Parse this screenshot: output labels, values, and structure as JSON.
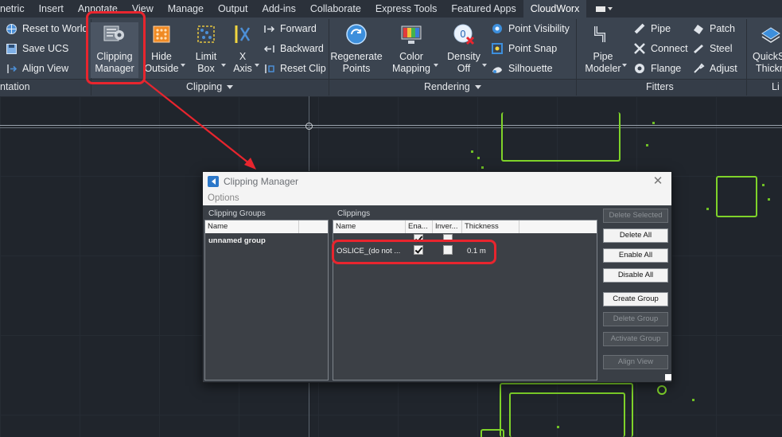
{
  "menubar": {
    "tabs": [
      "netric",
      "Insert",
      "Annotate",
      "View",
      "Manage",
      "Output",
      "Add-ins",
      "Collaborate",
      "Express Tools",
      "Featured Apps",
      "CloudWorx"
    ],
    "active": "CloudWorx"
  },
  "ribbon": {
    "view_panel": {
      "label": "ntation",
      "buttons": [
        "Reset to World",
        "Save UCS",
        "Align View"
      ]
    },
    "clipping_panel": {
      "label": "Clipping",
      "clipping_manager": [
        "Clipping",
        "Manager"
      ],
      "hide_outside": [
        "Hide",
        "Outside"
      ],
      "limit_box": [
        "Limit",
        "Box"
      ],
      "x_axis": [
        "X",
        "Axis"
      ],
      "forward": "Forward",
      "backward": "Backward",
      "reset_clip": "Reset Clip"
    },
    "rendering_panel": {
      "label": "Rendering",
      "regenerate_points": [
        "Regenerate",
        "Points"
      ],
      "color_mapping": [
        "Color",
        "Mapping"
      ],
      "density_off": [
        "Density",
        "Off"
      ],
      "point_visibility": "Point Visibility",
      "point_snap": "Point Snap",
      "silhouette": "Silhouette"
    },
    "fitters_panel": {
      "label": "Fitters",
      "pipe_modeler": [
        "Pipe",
        "Modeler"
      ],
      "pipe": "Pipe",
      "connect": "Connect",
      "flange": "Flange",
      "patch": "Patch",
      "steel": "Steel",
      "adjust": "Adjust"
    },
    "quick_panel": {
      "label": "Li",
      "quicks": [
        "QuickS",
        "Thickn"
      ]
    }
  },
  "dialog": {
    "title": "Clipping Manager",
    "options": "Options",
    "groups": {
      "label": "Clipping Groups",
      "header": "Name",
      "rows": [
        "unnamed group"
      ]
    },
    "clippings": {
      "label": "Clippings",
      "headers": [
        "Name",
        "Ena...",
        "Inver...",
        "Thickness"
      ],
      "rows": [
        {
          "name": "",
          "enabled": true,
          "inverted": false,
          "thickness": ""
        },
        {
          "name": "OSLICE_(do not ...",
          "enabled": true,
          "inverted": false,
          "thickness": "0.1 m"
        }
      ]
    },
    "buttons": {
      "delete_selected": "Delete Selected",
      "delete_all": "Delete All",
      "enable_all": "Enable All",
      "disable_all": "Disable All",
      "create_group": "Create Group",
      "delete_group": "Delete Group",
      "activate_group": "Activate Group",
      "align_view": "Align View"
    },
    "close": "✕"
  },
  "colors": {
    "annotation": "#e8252e",
    "points": "#7fd32a",
    "ribbon": "#3b4450"
  }
}
